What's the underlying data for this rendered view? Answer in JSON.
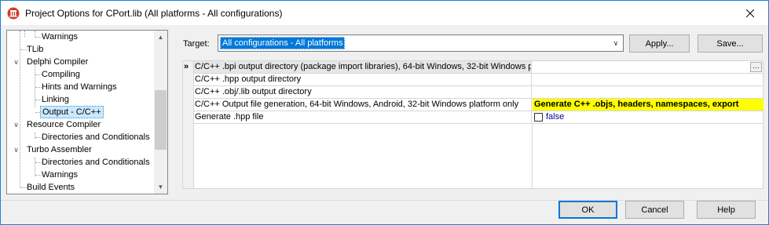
{
  "window": {
    "title": "Project Options for CPort.lib  (All platforms - All configurations)",
    "icon": "app-icon",
    "close_icon": "close-icon"
  },
  "tree": {
    "items": [
      {
        "label": "Warnings",
        "level": 2
      },
      {
        "label": "TLib",
        "level": 0
      },
      {
        "label": "Delphi Compiler",
        "level": 0,
        "expanded": true
      },
      {
        "label": "Compiling",
        "level": 1
      },
      {
        "label": "Hints and Warnings",
        "level": 1
      },
      {
        "label": "Linking",
        "level": 1
      },
      {
        "label": "Output - C/C++",
        "level": 1,
        "selected": true
      },
      {
        "label": "Resource Compiler",
        "level": 0,
        "expanded": true
      },
      {
        "label": "Directories and Conditionals",
        "level": 1
      },
      {
        "label": "Turbo Assembler",
        "level": 0,
        "expanded": true
      },
      {
        "label": "Directories and Conditionals",
        "level": 1
      },
      {
        "label": "Warnings",
        "level": 1
      },
      {
        "label": "Build Events",
        "level": 0
      }
    ]
  },
  "target": {
    "label": "Target:",
    "value": "All configurations - All platforms"
  },
  "buttons": {
    "apply": "Apply...",
    "save": "Save...",
    "ok": "OK",
    "cancel": "Cancel",
    "help": "Help"
  },
  "grid": {
    "marker": "»",
    "rows": [
      {
        "name": "C/C++ .bpi output directory (package import libraries), 64-bit Windows, 32-bit Windows p",
        "value": "",
        "has_ellipsis": true
      },
      {
        "name": "C/C++ .hpp output directory",
        "value": ""
      },
      {
        "name": "C/C++ .obj/.lib output directory",
        "value": ""
      },
      {
        "name": "C/C++ Output file generation, 64-bit Windows, Android, 32-bit Windows platform only",
        "value": "Generate C++ .objs, headers, namespaces, export",
        "highlight": true
      },
      {
        "name": "Generate .hpp file",
        "value": "false",
        "checkbox": true,
        "checked": false
      }
    ]
  },
  "colors": {
    "accent": "#0078d7",
    "highlight": "#ffff00",
    "false_value": "#0000a0"
  }
}
